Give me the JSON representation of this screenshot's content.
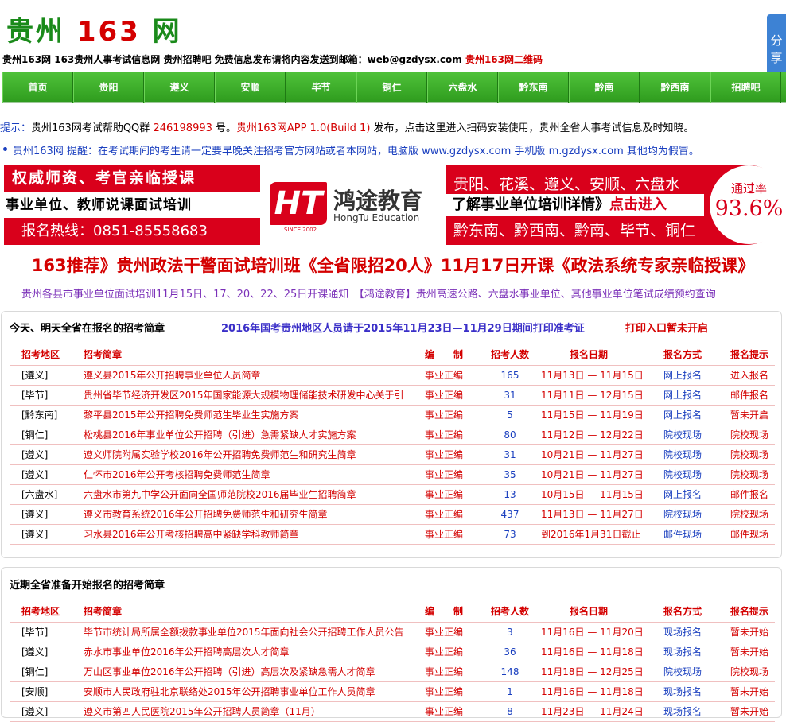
{
  "header": {
    "logo_main": "贵州",
    "logo_num": "163",
    "logo_tail": "网",
    "share_label": "分享",
    "subline_text": "贵州163网 163贵州人事考试信息网 贵州招聘吧 免费信息发布请将内容发送到邮箱：web@gzdysx.com",
    "subline_link": "贵州163网二维码"
  },
  "nav": [
    "首页",
    "贵阳",
    "遵义",
    "安顺",
    "毕节",
    "铜仁",
    "六盘水",
    "黔东南",
    "黔南",
    "黔西南",
    "招聘吧"
  ],
  "tips": {
    "tip1_label": "提示：",
    "tip1_text_a": "贵州163网考试帮助QQ群 ",
    "tip1_qq": "246198993",
    "tip1_text_b": " 号。",
    "tip1_app": "贵州163网APP 1.0(Build 1)",
    "tip1_text_c": " 发布，点击这里进入扫码安装使用，贵州全省人事考试信息及时知晓。",
    "tip2_text": "贵州163网 提醒：在考试期间的考生请一定要早晚关注招考官方网站或者本网站，电脑版 www.gzdysx.com 手机版 m.gzdysx.com 其他均为假冒。"
  },
  "banner": {
    "left_1": "权威师资、考官亲临授课",
    "left_2": "事业单位、教师说课面试培训",
    "left_3": "报名热线：0851-85558683",
    "brand_logo": "HT",
    "brand_cn": "鸿途教育",
    "brand_en": "HongTu Education",
    "brand_since": "SINCE 2002",
    "right_1": "贵阳、花溪、遵义、安顺、六盘水",
    "right_2a": "了解事业单位培训详情》",
    "right_2b": "点击进入",
    "right_3": "黔东南、黔西南、黔南、毕节、铜仁",
    "rate_label": "通过率",
    "rate_value": "93.6%"
  },
  "headline": "163推荐》贵州政法干警面试培训班《全省限招20人》11月17日开课《政法系统专家亲临授课》",
  "notice": "贵州各县市事业单位面试培训11月15日、17、20、22、25日开课通知　【鸿途教育】贵州高速公路、六盘水事业单位、其他事业单位笔试成绩预约查询",
  "panel1": {
    "title": "今天、明天全省在报名的招考简章",
    "title2": "2016年国考贵州地区人员请于2015年11月23日—11月29日期间打印准考证",
    "title3": "打印入口暂未开启",
    "columns": [
      "招考地区",
      "招考简章",
      "编　　制",
      "招考人数",
      "报名日期",
      "报名方式",
      "报名提示"
    ],
    "rows": [
      {
        "area": "[遵义]",
        "title": "遵义县2015年公开招聘事业单位人员简章",
        "type": "事业正编",
        "num": "165",
        "date": "11月13日 — 11月15日",
        "way": "网上报名",
        "tip": "进入报名"
      },
      {
        "area": "[毕节]",
        "title": "贵州省毕节经济开发区2015年国家能源大规模物理储能技术研发中心关于引",
        "type": "事业正编",
        "num": "31",
        "date": "11月11日 — 12月15日",
        "way": "网上报名",
        "tip": "邮件报名"
      },
      {
        "area": "[黔东南]",
        "title": "黎平县2015年公开招聘免费师范生毕业生实施方案",
        "type": "事业正编",
        "num": "5",
        "date": "11月15日 — 11月19日",
        "way": "网上报名",
        "tip": "暂未开启"
      },
      {
        "area": "[铜仁]",
        "title": "松桃县2016年事业单位公开招聘（引进）急需紧缺人才实施方案",
        "type": "事业正编",
        "num": "80",
        "date": "11月12日 — 12月22日",
        "way": "院校现场",
        "tip": "院校现场"
      },
      {
        "area": "[遵义]",
        "title": "遵义师院附属实验学校2016年公开招聘免费师范生和研究生简章",
        "type": "事业正编",
        "num": "31",
        "date": "10月21日 — 11月27日",
        "way": "院校现场",
        "tip": "院校现场"
      },
      {
        "area": "[遵义]",
        "title": "仁怀市2016年公开考核招聘免费师范生简章",
        "type": "事业正编",
        "num": "35",
        "date": "10月21日 — 11月27日",
        "way": "院校现场",
        "tip": "院校现场"
      },
      {
        "area": "[六盘水]",
        "title": "六盘水市第九中学公开面向全国师范院校2016届毕业生招聘简章",
        "type": "事业正编",
        "num": "13",
        "date": "10月15日 — 11月15日",
        "way": "网上报名",
        "tip": "邮件报名"
      },
      {
        "area": "[遵义]",
        "title": "遵义市教育系统2016年公开招聘免费师范生和研究生简章",
        "type": "事业正编",
        "num": "437",
        "date": "11月13日 — 11月27日",
        "way": "院校现场",
        "tip": "院校现场"
      },
      {
        "area": "[遵义]",
        "title": "习水县2016年公开考核招聘高中紧缺学科教师简章",
        "type": "事业正编",
        "num": "73",
        "date": "到2016年1月31日截止",
        "way": "邮件现场",
        "tip": "邮件现场"
      }
    ]
  },
  "panel2": {
    "title": "近期全省准备开始报名的招考简章",
    "columns": [
      "招考地区",
      "招考简章",
      "编　　制",
      "招考人数",
      "报名日期",
      "报名方式",
      "报名提示"
    ],
    "rows": [
      {
        "area": "[毕节]",
        "title": "毕节市统计局所属全额拨款事业单位2015年面向社会公开招聘工作人员公告",
        "type": "事业正编",
        "num": "3",
        "date": "11月16日 — 11月20日",
        "way": "现场报名",
        "tip": "暂未开始"
      },
      {
        "area": "[遵义]",
        "title": "赤水市事业单位2016年公开招聘高层次人才简章",
        "type": "事业正编",
        "num": "36",
        "date": "11月16日 — 11月18日",
        "way": "现场报名",
        "tip": "暂未开始"
      },
      {
        "area": "[铜仁]",
        "title": "万山区事业单位2016年公开招聘（引进）高层次及紧缺急需人才简章",
        "type": "事业正编",
        "num": "148",
        "date": "11月18日 — 12月25日",
        "way": "院校现场",
        "tip": "院校现场"
      },
      {
        "area": "[安顺]",
        "title": "安顺市人民政府驻北京联络处2015年公开招聘事业单位工作人员简章",
        "type": "事业正编",
        "num": "1",
        "date": "11月16日 — 11月18日",
        "way": "现场报名",
        "tip": "暂未开始"
      },
      {
        "area": "[遵义]",
        "title": "遵义市第四人民医院2015年公开招聘人员简章（11月）",
        "type": "事业正编",
        "num": "8",
        "date": "11月23日 — 11月24日",
        "way": "现场报名",
        "tip": "暂未开始"
      }
    ]
  },
  "colors": {
    "brand_green": "#2f9c1e",
    "accent_red": "#d40000",
    "link_blue": "#1a3fbf",
    "share_blue": "#3d82d4"
  }
}
